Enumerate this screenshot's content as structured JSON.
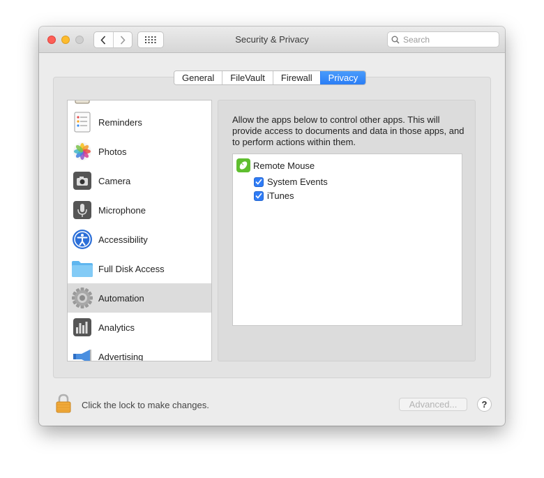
{
  "window": {
    "title": "Security & Privacy",
    "search_placeholder": "Search"
  },
  "tabs": [
    {
      "label": "General"
    },
    {
      "label": "FileVault"
    },
    {
      "label": "Firewall"
    },
    {
      "label": "Privacy",
      "active": true
    }
  ],
  "sidebar": {
    "items": [
      {
        "label": "Reminders",
        "icon": "reminders-icon"
      },
      {
        "label": "Photos",
        "icon": "photos-icon"
      },
      {
        "label": "Camera",
        "icon": "camera-icon"
      },
      {
        "label": "Microphone",
        "icon": "microphone-icon"
      },
      {
        "label": "Accessibility",
        "icon": "accessibility-icon"
      },
      {
        "label": "Full Disk Access",
        "icon": "folder-icon"
      },
      {
        "label": "Automation",
        "icon": "gear-icon",
        "selected": true
      },
      {
        "label": "Analytics",
        "icon": "analytics-icon"
      },
      {
        "label": "Advertising",
        "icon": "megaphone-icon"
      }
    ]
  },
  "automation": {
    "description": "Allow the apps below to control other apps. This will provide access to documents and data in those apps, and to perform actions within them.",
    "app": {
      "name": "Remote Mouse",
      "icon": "remote-mouse-icon"
    },
    "targets": [
      {
        "label": "System Events",
        "checked": true
      },
      {
        "label": "iTunes",
        "checked": true
      }
    ]
  },
  "footer": {
    "lock_text": "Click the lock to make changes.",
    "advanced_label": "Advanced...",
    "help_label": "?"
  },
  "colors": {
    "accent": "#2a7df5",
    "selection": "#dcdcdc"
  }
}
